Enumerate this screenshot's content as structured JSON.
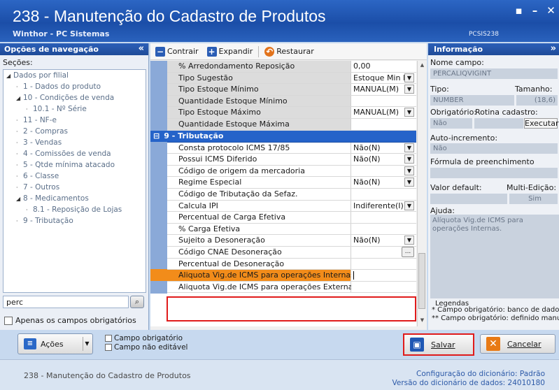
{
  "window": {
    "title": "238 - Manutenção do Cadastro de Produtos",
    "subtitle": "Winthor - PC Sistemas",
    "code": "PCSIS238",
    "btn_minimize": "▪",
    "btn_restore": "–",
    "btn_close": "✕"
  },
  "nav": {
    "header": "Opções de navegação",
    "collapse": "«",
    "sections_label": "Seções:",
    "tree": [
      {
        "label": "Dados por filial",
        "level": 0,
        "expanded": true
      },
      {
        "label": "1 - Dados do produto",
        "level": 1
      },
      {
        "label": "10 - Condições de venda",
        "level": 1,
        "expanded": true
      },
      {
        "label": "10.1 - Nº Série",
        "level": 2
      },
      {
        "label": "11 - NF-e",
        "level": 1
      },
      {
        "label": "2 - Compras",
        "level": 1
      },
      {
        "label": "3 - Vendas",
        "level": 1
      },
      {
        "label": "4 - Comissões de venda",
        "level": 1
      },
      {
        "label": "5 - Qtde mínima atacado",
        "level": 1
      },
      {
        "label": "6 - Classe",
        "level": 1
      },
      {
        "label": "7 - Outros",
        "level": 1
      },
      {
        "label": "8 - Medicamentos",
        "level": 1,
        "expanded": true
      },
      {
        "label": "8.1 - Reposição de Lojas",
        "level": 2
      },
      {
        "label": "9 - Tributação",
        "level": 1
      }
    ],
    "search_value": "perc",
    "only_required_label": "Apenas os campos obrigatórios"
  },
  "toolbar": {
    "collapse_label": "Contrair",
    "expand_label": "Expandir",
    "restore_label": "Restaurar"
  },
  "grid": {
    "rows": [
      {
        "name": "% Arredondamento Reposição",
        "value": "0,00",
        "control": "none",
        "grey": true
      },
      {
        "name": "Tipo Sugestão",
        "value": "Estoque Min M",
        "control": "dropdown",
        "grey": true
      },
      {
        "name": "Tipo Estoque Mínimo",
        "value": "MANUAL(M)",
        "control": "dropdown",
        "grey": true
      },
      {
        "name": "Quantidade Estoque Mínimo",
        "value": "",
        "control": "none",
        "grey": true
      },
      {
        "name": "Tipo Estoque Máximo",
        "value": "MANUAL(M)",
        "control": "dropdown",
        "grey": true
      },
      {
        "name": "Quantidade Estoque Máxima",
        "value": "",
        "control": "none",
        "grey": true
      }
    ],
    "section_title": "9 - Tributação",
    "section_rows": [
      {
        "name": "Consta protocolo ICMS 17/85",
        "value": "Não(N)",
        "control": "dropdown"
      },
      {
        "name": "Possui ICMS Diferido",
        "value": "Não(N)",
        "control": "dropdown"
      },
      {
        "name": "Código de origem da mercadoria",
        "value": "",
        "control": "dropdown"
      },
      {
        "name": "Regime Especial",
        "value": "Não(N)",
        "control": "dropdown"
      },
      {
        "name": "Código de Tributação da Sefaz.",
        "value": "",
        "control": "none"
      },
      {
        "name": "Calcula IPI",
        "value": "Indiferente(I)",
        "control": "dropdown"
      },
      {
        "name": "Percentual de Carga Efetiva",
        "value": "",
        "control": "none"
      },
      {
        "name": "% Carga Efetiva",
        "value": "",
        "control": "none"
      },
      {
        "name": "Sujeito a Desoneração",
        "value": "Não(N)",
        "control": "dropdown"
      },
      {
        "name": "Código CNAE Desoneração",
        "value": "",
        "control": "ellipsis"
      },
      {
        "name": "Percentual de Desoneração",
        "value": "",
        "control": "none"
      },
      {
        "name": "Aliquota Vig.de ICMS para operações Internas",
        "value": "",
        "control": "none",
        "highlight": true
      },
      {
        "name": "Aliquota Vig.de ICMS para operações Externas",
        "value": "",
        "control": "none"
      }
    ]
  },
  "info": {
    "header": "Informação",
    "expand": "»",
    "field_name_label": "Nome campo:",
    "field_name": "PERCALIQVIGINT",
    "type_label": "Tipo:",
    "size_label": "Tamanho:",
    "type": "NUMBER",
    "size": "(18,6)",
    "required_label": "Obrigatório:",
    "routine_label": "Rotina cadastro:",
    "required": "Não",
    "execute_label": "Executar",
    "autoinc_label": "Auto-incremento:",
    "autoinc": "Não",
    "formula_label": "Fórmula de preenchimento",
    "default_label": "Valor default:",
    "multiedit_label": "Multi-Edição:",
    "multiedit": "Sim",
    "help_label": "Ajuda:",
    "help_text": "Alíquota Vig.de ICMS para operações Internas.",
    "legend_title": "Legendas",
    "legend_1": "* Campo obrigatório: banco de dados",
    "legend_2": "** Campo obrigatório: definido manual"
  },
  "bottom": {
    "actions_label": "Ações",
    "legend_required": "Campo obrigatório",
    "legend_noneditable": "Campo não editável",
    "save_label": "Salvar",
    "cancel_label": "Cancelar"
  },
  "status": {
    "left": "238 - Manutenção do Cadastro de Produtos",
    "dict_config": "Configuração do dicionário: Padrão",
    "dict_version": "Versão do dicionário de dados: 24010180"
  },
  "colors": {
    "title_bar": "#1b4ea8",
    "section_header": "#2563c9",
    "highlight_row": "#f28c1a",
    "red_frame": "#e01b1b"
  }
}
